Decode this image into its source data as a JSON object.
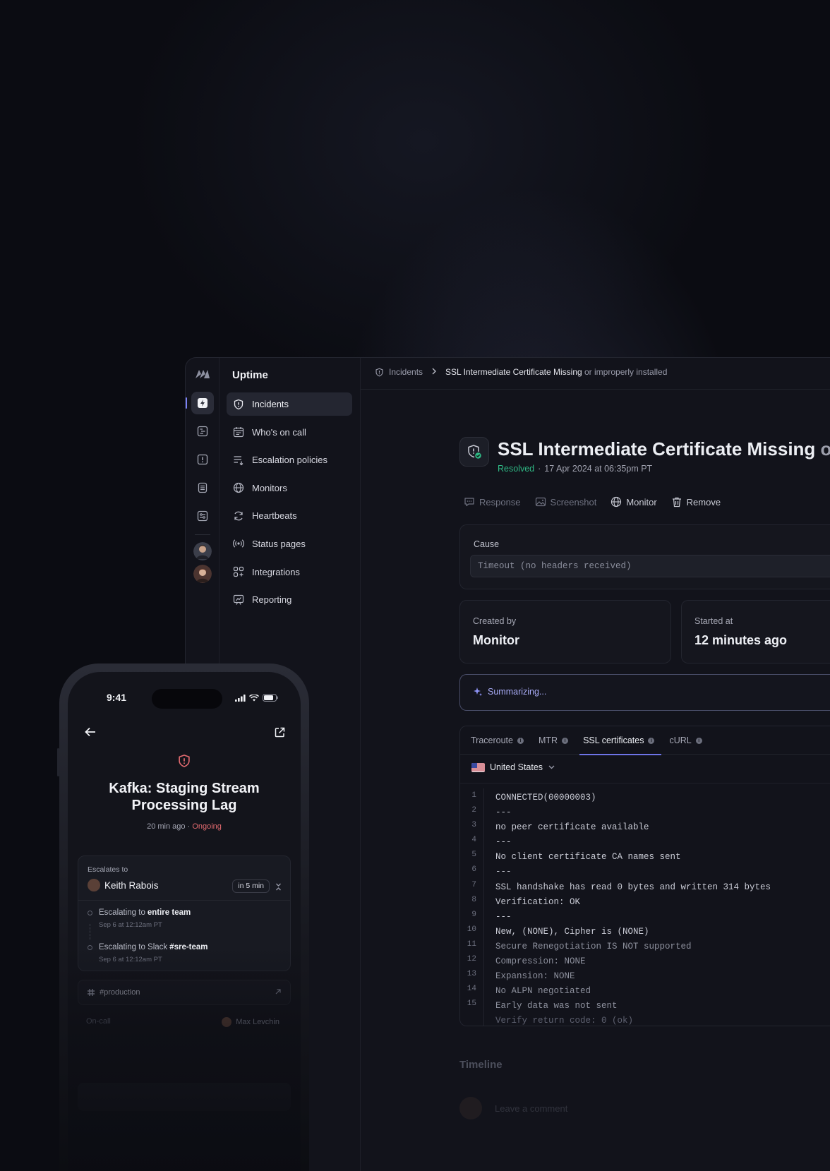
{
  "app": {
    "name": "Uptime"
  },
  "nav": {
    "items": [
      {
        "label": "Incidents",
        "icon": "shield-alert-icon",
        "active": true
      },
      {
        "label": "Who's on call",
        "icon": "calendar-icon",
        "active": false
      },
      {
        "label": "Escalation policies",
        "icon": "escalation-list-icon",
        "active": false
      },
      {
        "label": "Monitors",
        "icon": "globe-icon",
        "active": false
      },
      {
        "label": "Heartbeats",
        "icon": "refresh-icon",
        "active": false
      },
      {
        "label": "Status pages",
        "icon": "broadcast-icon",
        "active": false
      },
      {
        "label": "Integrations",
        "icon": "integrations-icon",
        "active": false
      },
      {
        "label": "Reporting",
        "icon": "chart-board-icon",
        "active": false
      }
    ]
  },
  "breadcrumb": {
    "root": "Incidents",
    "current_main": "SSL Intermediate Certificate Missing",
    "current_rest": " or improperly installed"
  },
  "incident": {
    "title_main": "SSL Intermediate Certificate Missing",
    "title_fade": " or",
    "status": "Resolved",
    "timestamp": "17 Apr 2024 at 06:35pm PT",
    "actions": [
      {
        "label": "Response",
        "icon": "chat-icon",
        "enabled": false
      },
      {
        "label": "Screenshot",
        "icon": "image-icon",
        "enabled": false
      },
      {
        "label": "Monitor",
        "icon": "globe-icon",
        "enabled": true
      },
      {
        "label": "Remove",
        "icon": "trash-icon",
        "enabled": true
      }
    ],
    "cause": {
      "label": "Cause",
      "value": "Timeout (no headers received)"
    },
    "created_by": {
      "label": "Created by",
      "value": "Monitor"
    },
    "started_at": {
      "label": "Started at",
      "value": "12 minutes ago"
    },
    "summary": "Summarizing..."
  },
  "diagnostics": {
    "tabs": [
      {
        "label": "Traceroute",
        "active": false
      },
      {
        "label": "MTR",
        "active": false
      },
      {
        "label": "SSL certificates",
        "active": true
      },
      {
        "label": "cURL",
        "active": false
      }
    ],
    "region": "United States",
    "lines": [
      "CONNECTED(00000003)",
      "---",
      "no peer certificate available",
      "---",
      "No client certificate CA names sent",
      "---",
      "SSL handshake has read 0 bytes and written 314 bytes",
      "Verification: OK",
      "---",
      "New, (NONE), Cipher is (NONE)",
      "Secure Renegotiation IS NOT supported",
      "Compression: NONE",
      "Expansion: NONE",
      "No ALPN negotiated",
      "Early data was not sent",
      "Verify return code: 0 (ok)"
    ],
    "line_numbers": [
      "1",
      "2",
      "3",
      "4",
      "5",
      "6",
      "7",
      "8",
      "9",
      "10",
      "11",
      "12",
      "13",
      "14",
      "15"
    ]
  },
  "timeline": {
    "title": "Timeline",
    "comment_placeholder": "Leave a comment",
    "comment_hint": "…"
  },
  "phone": {
    "time": "9:41",
    "incident_title": "Kafka: Staging Stream Processing Lag",
    "age": "20 min ago",
    "status": "Ongoing",
    "escalates_label": "Escalates to",
    "escalates_user": "Keith Rabois",
    "escalates_in": "in 5 min",
    "steps": [
      {
        "prefix": "Escalating to",
        "target": "entire team",
        "when": "Sep 6 at 12:12am PT"
      },
      {
        "prefix": "Escalating to Slack",
        "target": "#sre-team",
        "when": "Sep 6 at 12:12am PT"
      }
    ],
    "channel": "#production",
    "oncall_label": "On-call",
    "oncall_user": "Max Levchin"
  },
  "colors": {
    "accent": "#6e74e8",
    "resolved": "#2fb985",
    "ongoing": "#e26a6f",
    "background": "#0b0c12"
  }
}
